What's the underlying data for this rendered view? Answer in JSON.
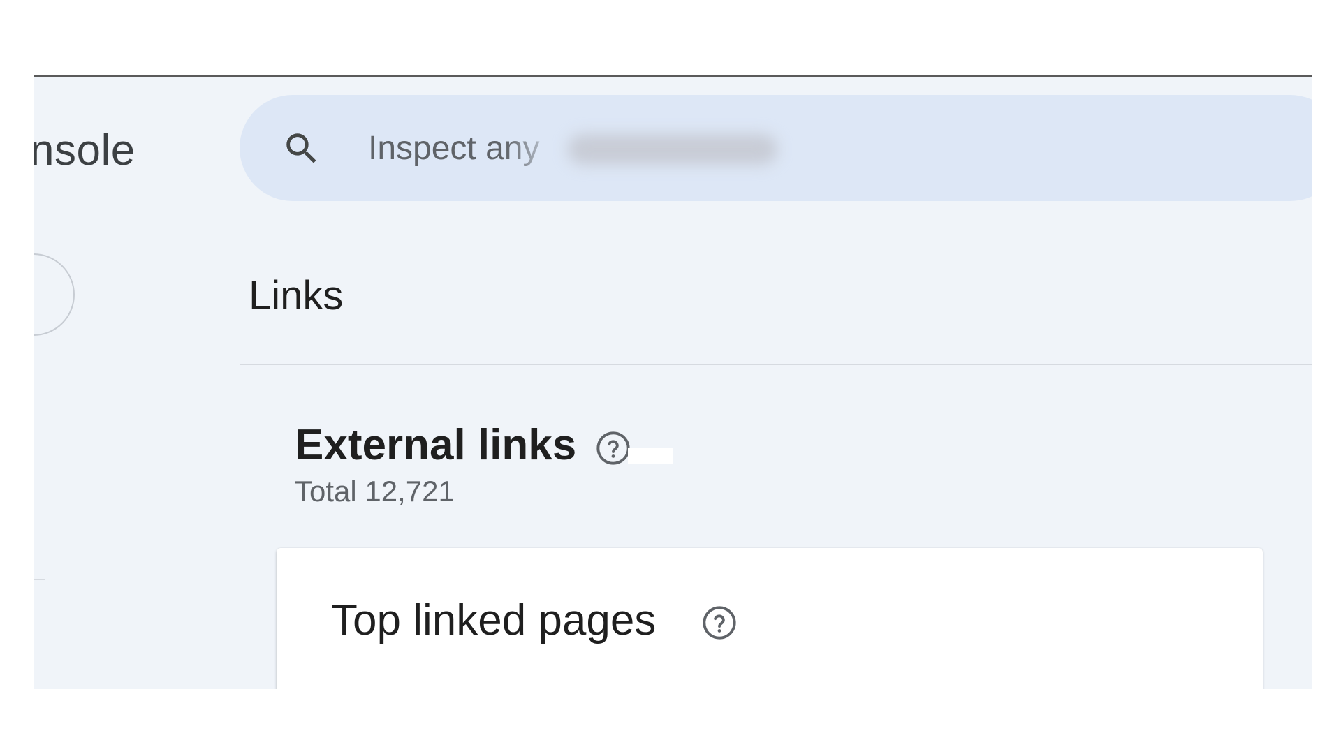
{
  "header": {
    "app_title_visible": "nsole"
  },
  "search": {
    "placeholder": "Inspect any URL in",
    "icon": "search-icon"
  },
  "page": {
    "title": "Links"
  },
  "external_links": {
    "title": "External links",
    "total": "Total 12,721",
    "help_icon": "help-circle-icon"
  },
  "top_linked_pages": {
    "title": "Top linked pages",
    "help_icon": "help-circle-icon"
  },
  "colors": {
    "app_background": "#f0f4f9",
    "search_background": "#dde7f6",
    "text_primary": "#1f1f1f",
    "text_secondary": "#5f6368",
    "card_background": "#ffffff"
  }
}
